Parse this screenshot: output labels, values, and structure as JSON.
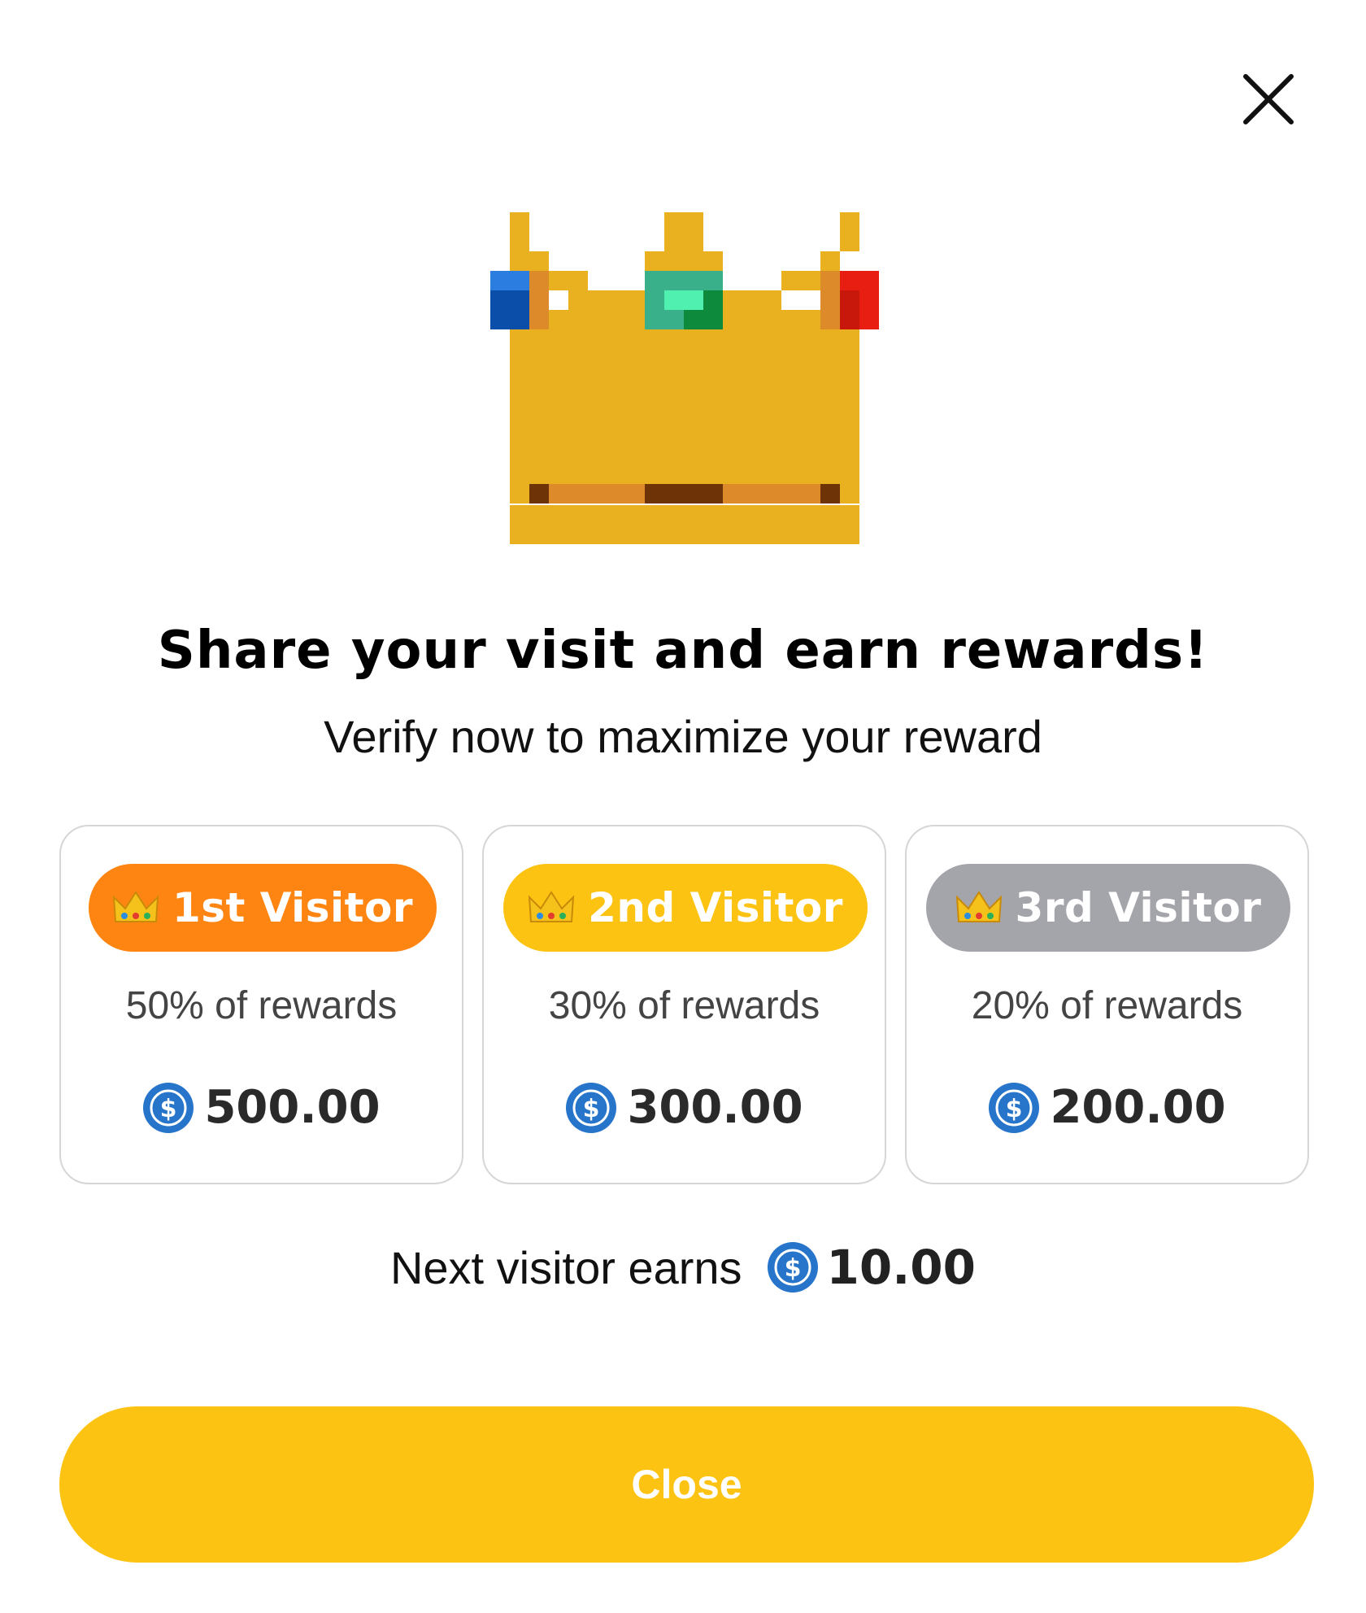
{
  "header": {
    "close_icon": "close-icon"
  },
  "hero": {
    "icon": "pixel-crown-icon"
  },
  "title": "Share your visit and earn rewards!",
  "subtitle": "Verify now to maximize your reward",
  "tiers": [
    {
      "label": "1st Visitor",
      "percent_text": "50% of rewards",
      "amount": "500.00",
      "color": "#ff8512",
      "icon": "crown-emoji-icon"
    },
    {
      "label": "2nd Visitor",
      "percent_text": "30% of rewards",
      "amount": "300.00",
      "color": "#fdc313",
      "icon": "crown-emoji-icon"
    },
    {
      "label": "3rd Visitor",
      "percent_text": "20% of rewards",
      "amount": "200.00",
      "color": "#a4a5ab",
      "icon": "crown-emoji-icon"
    }
  ],
  "coin_icon": "usdc-coin-icon",
  "next_visitor": {
    "label": "Next visitor earns",
    "amount": "10.00"
  },
  "footer": {
    "close_label": "Close",
    "button_color": "#fdc313"
  }
}
